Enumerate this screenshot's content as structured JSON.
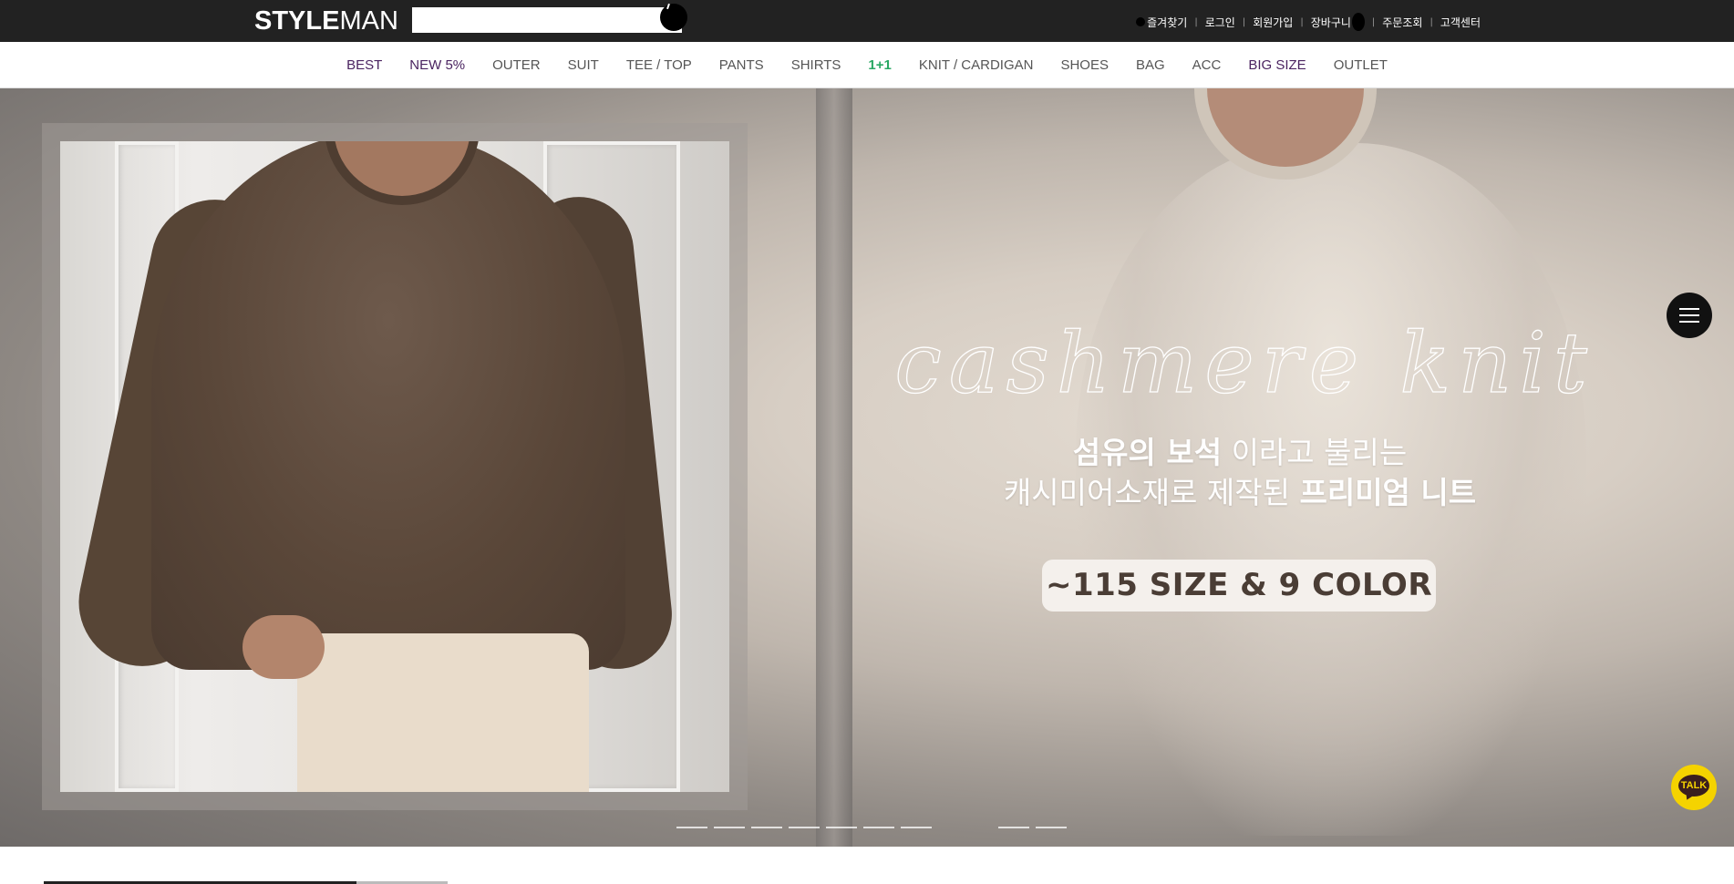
{
  "header": {
    "logo_bold": "STYLE",
    "logo_light": "MAN",
    "search": {
      "value": "",
      "placeholder": ""
    },
    "util_links": [
      "즐겨찾기",
      "로그인",
      "회원가입",
      "장바구니",
      "주문조회",
      "고객센터"
    ]
  },
  "nav": {
    "items": [
      {
        "label": "BEST",
        "color": "#4a2360"
      },
      {
        "label": "NEW 5%",
        "color": "#4a2360"
      },
      {
        "label": "OUTER",
        "color": "#555555"
      },
      {
        "label": "SUIT",
        "color": "#555555"
      },
      {
        "label": "TEE / TOP",
        "color": "#555555"
      },
      {
        "label": "PANTS",
        "color": "#555555"
      },
      {
        "label": "SHIRTS",
        "color": "#555555"
      },
      {
        "label": "1+1",
        "color": "#2aa864"
      },
      {
        "label": "KNIT / CARDIGAN",
        "color": "#555555"
      },
      {
        "label": "SHOES",
        "color": "#555555"
      },
      {
        "label": "BAG",
        "color": "#555555"
      },
      {
        "label": "ACC",
        "color": "#555555"
      },
      {
        "label": "BIG SIZE",
        "color": "#4a2360"
      },
      {
        "label": "OUTLET",
        "color": "#555555"
      }
    ]
  },
  "hero": {
    "script_title": "cashmere knit",
    "line1_bold": "섬유의 보석",
    "line1_light": " 이라고 불리는",
    "line2_light": "캐시미어소재로 제작된 ",
    "line2_bold": "프리미엄 니트",
    "pill": "~115 SIZE & 9 COLOR",
    "slide_count": 9
  },
  "floating": {
    "talk_label": "TALK"
  },
  "colors": {
    "topbar": "#222222",
    "nav_accent": "#4a2360",
    "green_accent": "#2aa864",
    "talk_yellow": "#f5d300"
  }
}
